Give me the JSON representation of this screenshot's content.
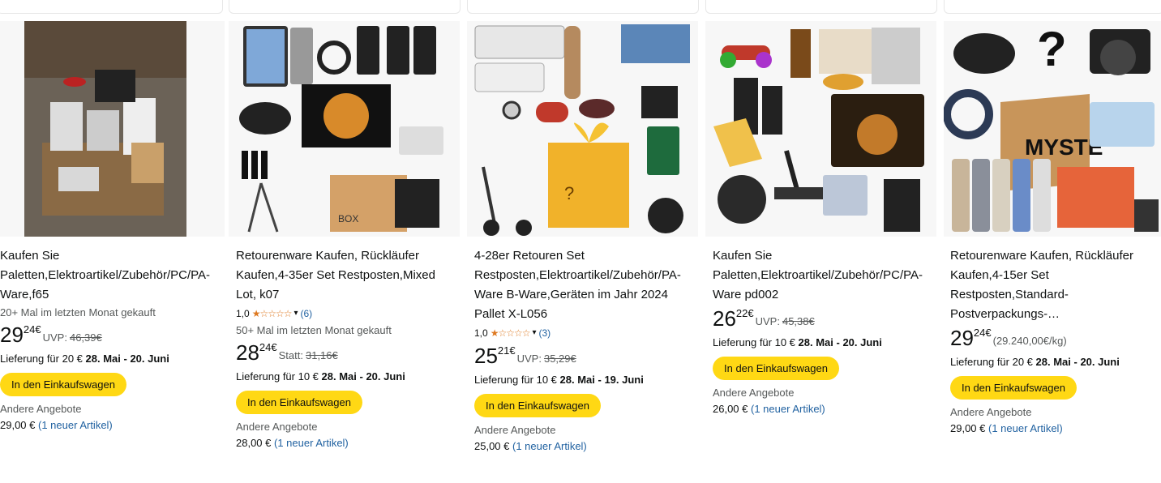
{
  "products": [
    {
      "title": "Kaufen Sie Paletten,Elektroartikel/Zubehör/PC/PA-Ware,f65",
      "bought": "20+ Mal im letzten Monat gekauft",
      "rating": null,
      "price_whole": "29",
      "price_frac": "24",
      "currency": "€",
      "compare_label": "UVP:",
      "compare_value": "46,39€",
      "delivery_prefix": "Lieferung für 20 €",
      "delivery_dates": "28. Mai - 20. Juni",
      "button": "In den Einkaufswagen",
      "other_label": "Andere Angebote",
      "other_price": "29,00 €",
      "other_link": "(1 neuer Artikel)"
    },
    {
      "title": "Retourenware Kaufen, Rückläufer Kaufen,4-35er Set Restposten,Mixed Lot, k07",
      "bought": "50+ Mal im letzten Monat gekauft",
      "rating": {
        "value": "1,0",
        "stars": "★☆☆☆☆",
        "count": "(6)"
      },
      "price_whole": "28",
      "price_frac": "24",
      "currency": "€",
      "compare_label": "Statt:",
      "compare_value": "31,16€",
      "delivery_prefix": "Lieferung für 10 €",
      "delivery_dates": "28. Mai - 20. Juni",
      "button": "In den Einkaufswagen",
      "other_label": "Andere Angebote",
      "other_price": "28,00 €",
      "other_link": "(1 neuer Artikel)"
    },
    {
      "title": "4-28er Retouren Set Restposten,Elektroartikel/Zubehör/PA-Ware B-Ware,Geräten im Jahr 2024 Pallet X-L056",
      "bought": null,
      "rating": {
        "value": "1,0",
        "stars": "★☆☆☆☆",
        "count": "(3)"
      },
      "price_whole": "25",
      "price_frac": "21",
      "currency": "€",
      "compare_label": "UVP:",
      "compare_value": "35,29€",
      "delivery_prefix": "Lieferung für 10 €",
      "delivery_dates": "28. Mai - 19. Juni",
      "button": "In den Einkaufswagen",
      "other_label": "Andere Angebote",
      "other_price": "25,00 €",
      "other_link": "(1 neuer Artikel)"
    },
    {
      "title": "Kaufen Sie Paletten,Elektroartikel/Zubehör/PC/PA-Ware pd002",
      "bought": null,
      "rating": null,
      "price_whole": "26",
      "price_frac": "22",
      "currency": "€",
      "compare_label": "UVP:",
      "compare_value": "45,38€",
      "delivery_prefix": "Lieferung für 10 €",
      "delivery_dates": "28. Mai - 20. Juni",
      "button": "In den Einkaufswagen",
      "other_label": "Andere Angebote",
      "other_price": "26,00 €",
      "other_link": "(1 neuer Artikel)"
    },
    {
      "title": "Retourenware Kaufen, Rückläufer Kaufen,4-15er Set Restposten,Standard-Postverpackungs-…",
      "bought": null,
      "rating": null,
      "price_whole": "29",
      "price_frac": "24",
      "currency": "€",
      "compare_label": "(29.240,00€/kg)",
      "compare_value": "",
      "delivery_prefix": "Lieferung für 20 €",
      "delivery_dates": "28. Mai - 20. Juni",
      "button": "In den Einkaufswagen",
      "other_label": "Andere Angebote",
      "other_price": "29,00 €",
      "other_link": "(1 neuer Artikel)"
    }
  ],
  "colors": {
    "button": "#ffd814",
    "link": "#2162a1",
    "star": "#de7921"
  }
}
